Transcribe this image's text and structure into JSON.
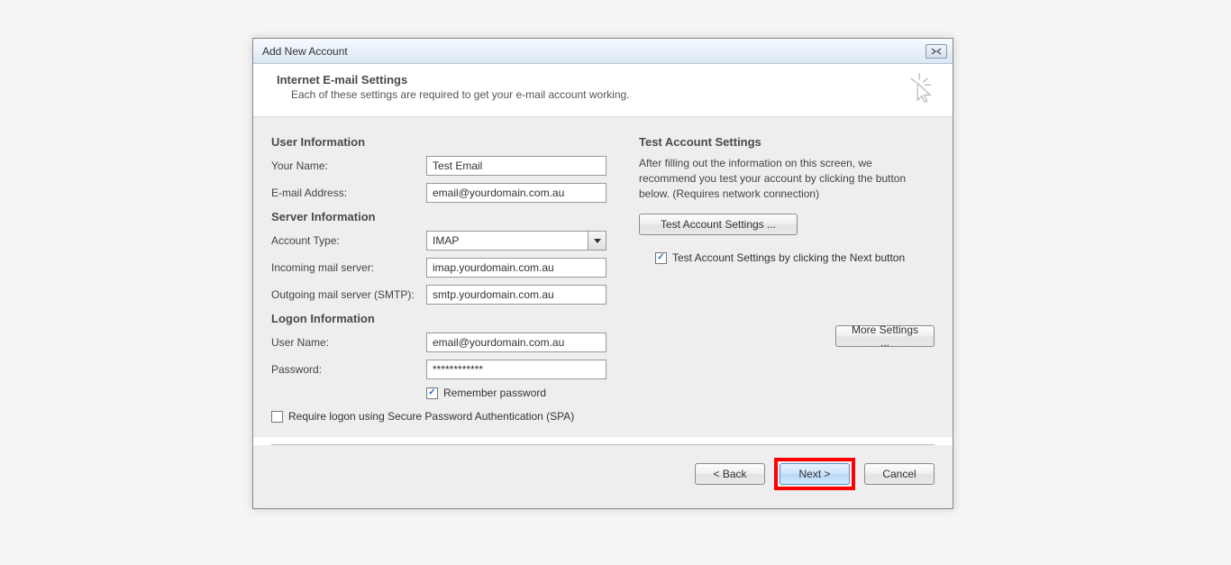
{
  "titlebar": {
    "title": "Add New Account"
  },
  "header": {
    "title": "Internet E-mail Settings",
    "subtitle": "Each of these settings are required to get your e-mail account working."
  },
  "sections": {
    "user_info": "User Information",
    "server_info": "Server Information",
    "logon_info": "Logon Information",
    "test": "Test Account Settings"
  },
  "labels": {
    "your_name": "Your Name:",
    "email": "E-mail Address:",
    "account_type": "Account Type:",
    "incoming": "Incoming mail server:",
    "outgoing": "Outgoing mail server (SMTP):",
    "user_name": "User Name:",
    "password": "Password:",
    "remember_password": "Remember password",
    "require_spa": "Require logon using Secure Password Authentication (SPA)",
    "test_desc": "After filling out the information on this screen, we recommend you test your account by clicking the button below. (Requires network connection)",
    "test_checkbox": "Test Account Settings by clicking the Next button"
  },
  "values": {
    "your_name": "Test Email",
    "email": "email@yourdomain.com.au",
    "account_type": "IMAP",
    "incoming": "imap.yourdomain.com.au",
    "outgoing": "smtp.yourdomain.com.au",
    "user_name": "email@yourdomain.com.au",
    "password": "************"
  },
  "buttons": {
    "test": "Test Account Settings ...",
    "more": "More Settings ...",
    "back": "< Back",
    "next": "Next >",
    "cancel": "Cancel"
  },
  "checks": {
    "remember_password": true,
    "require_spa": false,
    "test_next": true
  }
}
